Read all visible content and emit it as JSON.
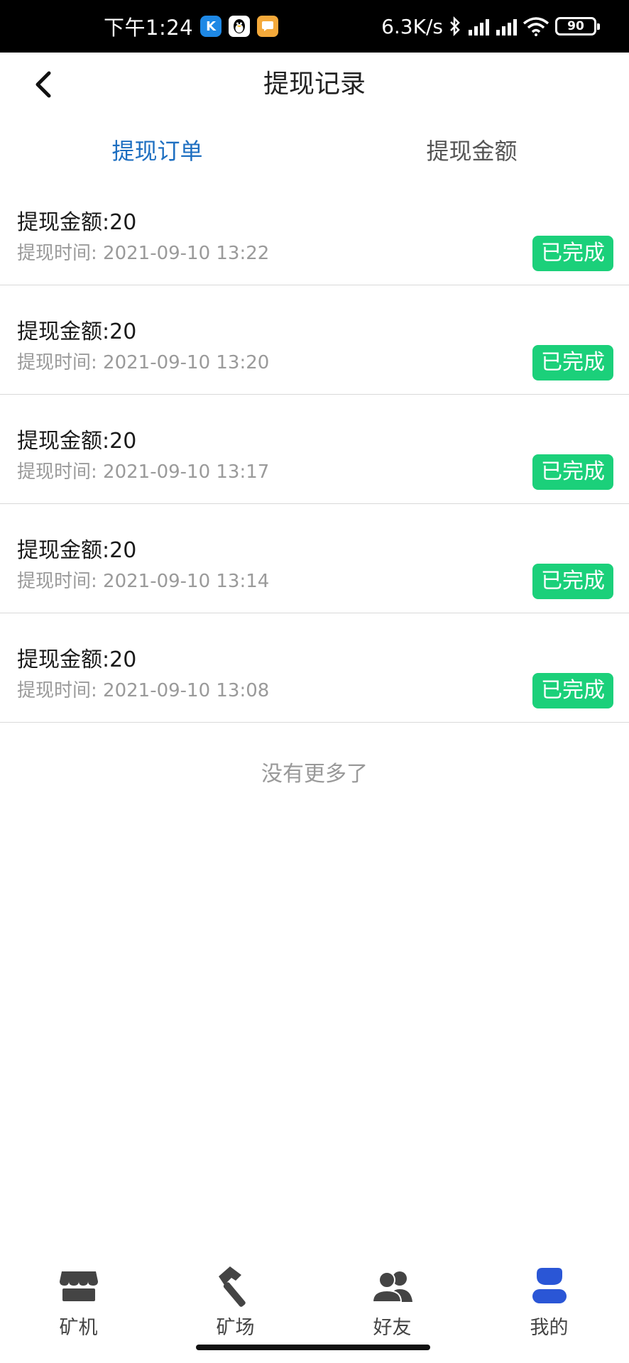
{
  "status_bar": {
    "time": "下午1:24",
    "app_icons": [
      "K",
      "QQ",
      "消息"
    ],
    "network_speed": "6.3K/s",
    "battery": "90"
  },
  "header": {
    "back_icon": "chevron-left-icon",
    "title": "提现记录"
  },
  "tabs": [
    {
      "label": "提现订单",
      "active": true
    },
    {
      "label": "提现金额",
      "active": false
    }
  ],
  "records": [
    {
      "amount": "提现金额:20",
      "time": "提现时间: 2021-09-10 13:22",
      "status": "已完成"
    },
    {
      "amount": "提现金额:20",
      "time": "提现时间: 2021-09-10 13:20",
      "status": "已完成"
    },
    {
      "amount": "提现金额:20",
      "time": "提现时间: 2021-09-10 13:17",
      "status": "已完成"
    },
    {
      "amount": "提现金额:20",
      "time": "提现时间: 2021-09-10 13:14",
      "status": "已完成"
    },
    {
      "amount": "提现金额:20",
      "time": "提现时间: 2021-09-10 13:08",
      "status": "已完成"
    }
  ],
  "no_more_text": "没有更多了",
  "bottom_nav": [
    {
      "label": "矿机",
      "icon": "shop-icon",
      "active": false
    },
    {
      "label": "矿场",
      "icon": "hammer-icon",
      "active": false
    },
    {
      "label": "好友",
      "icon": "friends-icon",
      "active": false
    },
    {
      "label": "我的",
      "icon": "user-icon",
      "active": true
    }
  ],
  "colors": {
    "accent": "#1e6fc1",
    "status_done": "#1bd07a",
    "nav_active_icon": "#2a56d6",
    "nav_icon": "#444444"
  }
}
